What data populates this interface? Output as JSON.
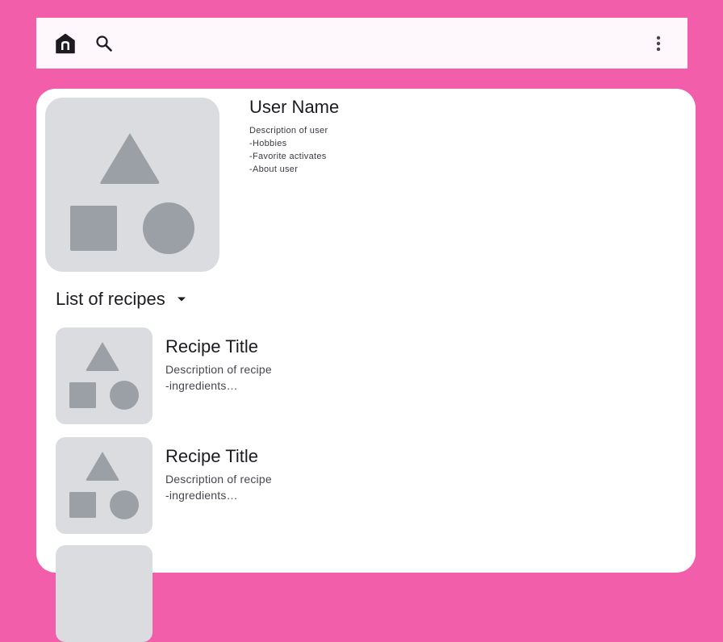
{
  "topbar": {
    "icons": [
      "home-icon",
      "search-icon",
      "more-vert-icon"
    ]
  },
  "profile": {
    "name": "User Name",
    "description_lines": [
      "Description of user",
      "-Hobbies",
      "-Favorite activates",
      "-About user"
    ]
  },
  "recipes": {
    "header": "List of recipes",
    "items": [
      {
        "title": "Recipe Title",
        "description_lines": [
          "Description of recipe",
          "-ingredients…"
        ]
      },
      {
        "title": "Recipe Title",
        "description_lines": [
          "Description of recipe",
          "-ingredients…"
        ]
      }
    ]
  },
  "colors": {
    "background": "#F25EAA",
    "topbar": "#FEF7FB",
    "card": "#FFFFFF",
    "placeholder": "#DBDCDF",
    "placeholder_shape": "#9AA0A6",
    "text_primary": "#1D1B20"
  }
}
